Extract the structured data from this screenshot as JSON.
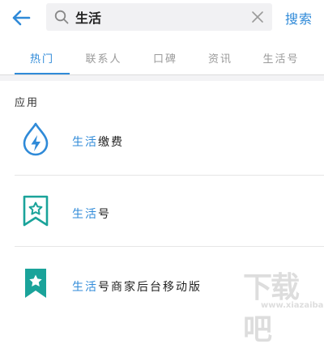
{
  "search": {
    "query": "生活",
    "button_label": "搜索"
  },
  "tabs": [
    {
      "label": "热门",
      "active": true
    },
    {
      "label": "联系人",
      "active": false
    },
    {
      "label": "口碑",
      "active": false
    },
    {
      "label": "资讯",
      "active": false
    },
    {
      "label": "生活号",
      "active": false
    }
  ],
  "section": {
    "title": "应用"
  },
  "results": [
    {
      "highlight": "生活",
      "rest": "缴费",
      "icon": "lightning-drop-icon"
    },
    {
      "highlight": "生活",
      "rest": "号",
      "icon": "star-bookmark-outline-icon"
    },
    {
      "highlight": "生活",
      "rest": "号商家后台移动版",
      "icon": "star-bookmark-filled-icon"
    }
  ],
  "watermark": {
    "main": "下载吧",
    "sub": "www.xiazaiba.com"
  },
  "colors": {
    "accent": "#2f8ad8",
    "teal": "#1aa39a",
    "divider": "#e6e6e6"
  }
}
